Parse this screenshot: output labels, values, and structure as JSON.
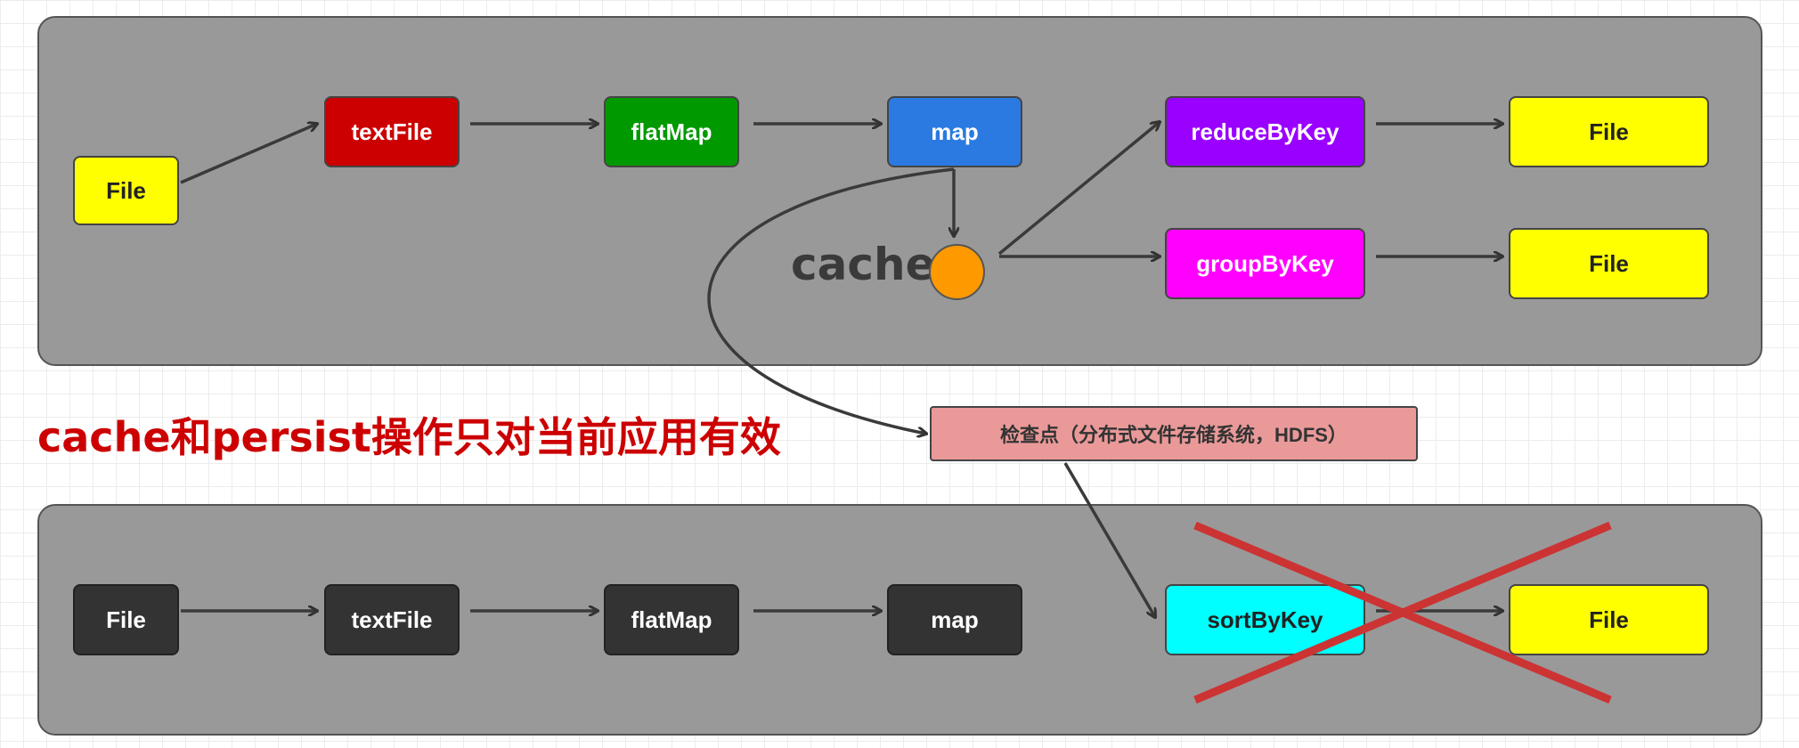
{
  "top_pipeline": {
    "file_in": "File",
    "textfile": "textFile",
    "flatmap": "flatMap",
    "map": "map",
    "cache_label": "cache",
    "reducebykey": "reduceByKey",
    "groupbykey": "groupByKey",
    "file_out_reduce": "File",
    "file_out_group": "File"
  },
  "headline": "cache和persist操作只对当前应用有效",
  "checkpoint": "检查点（分布式文件存储系统，HDFS）",
  "bottom_pipeline": {
    "file_in": "File",
    "textfile": "textFile",
    "flatmap": "flatMap",
    "map": "map",
    "sortbykey": "sortByKey",
    "file_out": "File"
  },
  "colors": {
    "panel": "#999999",
    "file": "#ffff00",
    "textfile": "#cc0000",
    "flatmap": "#009900",
    "map": "#2a7ae2",
    "reducebykey": "#9900ff",
    "groupbykey": "#ff00ff",
    "cache_circle": "#ff9900",
    "checkpoint": "#ea9999",
    "sortbykey": "#00ffff",
    "dark_node": "#333333",
    "cross_mark": "#cc3333",
    "headline": "#cc0000"
  }
}
